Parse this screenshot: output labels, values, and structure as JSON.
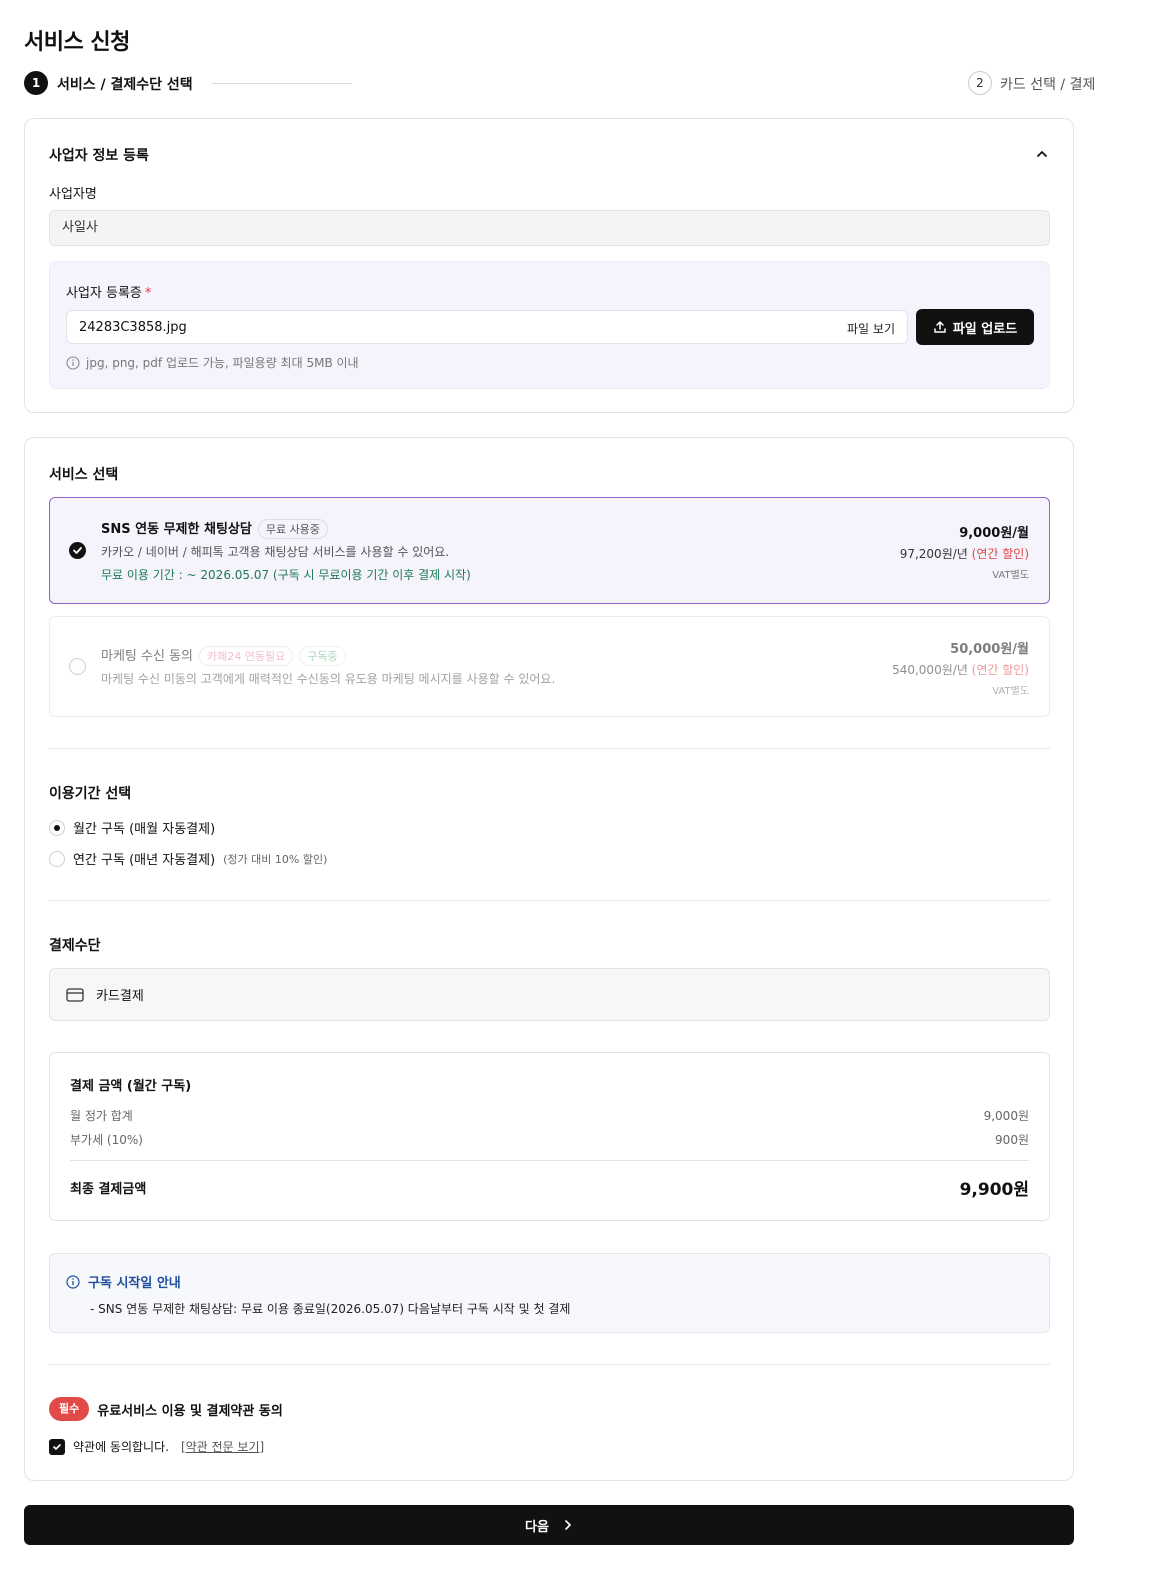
{
  "page": {
    "title": "서비스 신청"
  },
  "stepper": {
    "step1": {
      "num": "1",
      "label": "서비스 / 결제수단 선택"
    },
    "step2": {
      "num": "2",
      "label": "카드 선택 / 결제"
    }
  },
  "business": {
    "section_title": "사업자 정보 등록",
    "name_label": "사업자명",
    "name_value": "사일사",
    "reg_label": "사업자 등록증",
    "required_mark": "*",
    "file_name": "24283C3858.jpg",
    "file_view_label": "파일 보기",
    "upload_label": "파일 업로드",
    "hint": "jpg, png, pdf 업로드 가능, 파일용량 최대 5MB 이내"
  },
  "services": {
    "section_title": "서비스 선택",
    "items": [
      {
        "name": "SNS 연동 무제한 채팅상담",
        "badges": [
          "무료 사용중"
        ],
        "desc": "카카오 / 네이버 / 해피톡 고객용 채팅상담 서비스를 사용할 수 있어요.",
        "free_period": "무료 이용 기간 : ~ 2026.05.07 (구독 시 무료이용 기간 이후 결제 시작)",
        "price_month": "9,000원/월",
        "price_year": "97,200원/년",
        "discount": "(연간 할인)",
        "vat": "VAT별도",
        "checked": true
      },
      {
        "name": "마케팅 수신 동의",
        "badges": [
          "카페24 연동필요",
          "구독중"
        ],
        "desc": "마케팅 수신 미동의 고객에게 매력적인 수신동의 유도용 마케팅 메시지를 사용할 수 있어요.",
        "price_month": "50,000원/월",
        "price_year": "540,000원/년",
        "discount": "(연간 할인)",
        "vat": "VAT별도",
        "checked": false
      }
    ]
  },
  "period": {
    "section_title": "이용기간 선택",
    "options": [
      {
        "label": "월간 구독 (매월 자동결제)",
        "sub": "",
        "selected": true
      },
      {
        "label": "연간 구독 (매년 자동결제)",
        "sub": "(정가 대비 10% 할인)",
        "selected": false
      }
    ]
  },
  "payment": {
    "section_title": "결제수단",
    "method": "카드결제",
    "method_icon": "credit-card-icon"
  },
  "summary": {
    "title": "결제 금액 (월간 구독)",
    "rows": [
      {
        "label": "월 정가 합계",
        "value": "9,000원"
      },
      {
        "label": "부가세 (10%)",
        "value": "900원"
      }
    ],
    "total_label": "최종 결제금액",
    "total_value": "9,900원"
  },
  "notice": {
    "title": "구독 시작일 안내",
    "text": "- SNS 연동 무제한 채팅상담: 무료 이용 종료일(2026.05.07) 다음날부터 구독 시작 및 첫 결제"
  },
  "terms": {
    "required_badge": "필수",
    "title": "유료서비스 이용 및 결제약관 동의",
    "agree_label": "약관에 동의합니다.",
    "link_label": "[약관 전문 보기]",
    "agreed": true
  },
  "next_button": {
    "label": "다음"
  },
  "colors": {
    "accent_dark": "#111111",
    "selected_border": "#8c63c6",
    "selected_bg": "#f5f4fd",
    "discount": "#e04444",
    "free_text": "#1f7a52",
    "notice_title": "#1e4e9c",
    "required_badge": "#e24a4a"
  }
}
